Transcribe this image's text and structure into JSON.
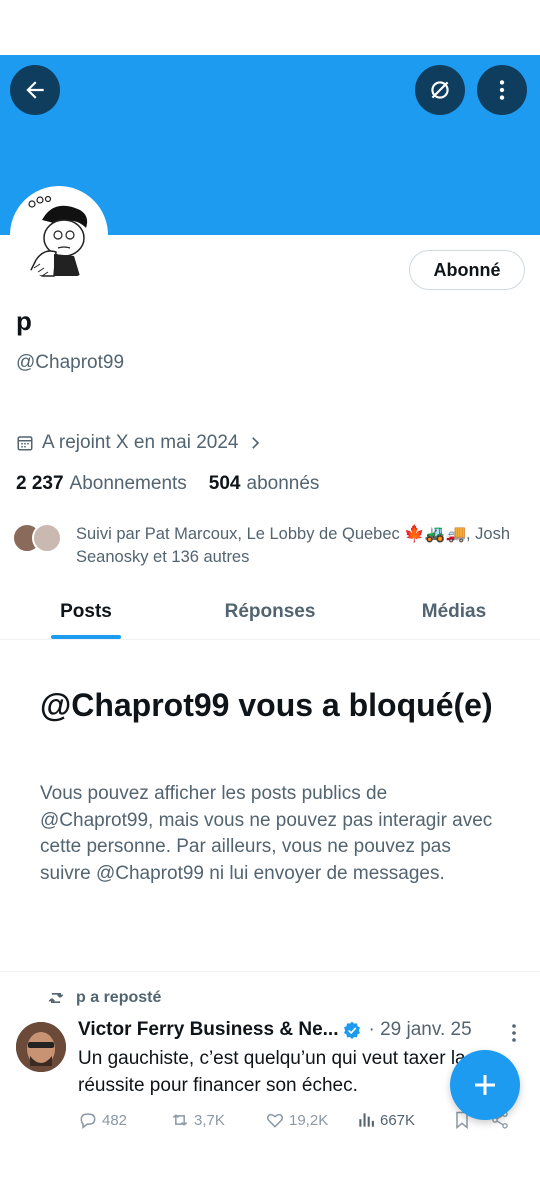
{
  "profile": {
    "display_name": "p",
    "handle": "@Chaprot99",
    "follow_button_label": "Abonné",
    "joined": "A rejoint X en mai 2024",
    "following_count": "2 237",
    "following_label": "Abonnements",
    "followers_count": "504",
    "followers_label": "abonnés",
    "followed_by": "Suivi par Pat Marcoux, Le Lobby de Quebec 🍁🚜🚚, Josh Seanosky et 136 autres"
  },
  "tabs": [
    {
      "label": "Posts",
      "active": true
    },
    {
      "label": "Réponses",
      "active": false
    },
    {
      "label": "Médias",
      "active": false
    }
  ],
  "blocked": {
    "title": "@Chaprot99 vous a bloqué(e)",
    "description": "Vous pouvez afficher les posts publics de @Chaprot99, mais vous ne pouvez pas interagir avec cette personne. Par ailleurs, vous ne pouvez pas suivre @Chaprot99 ni lui envoyer de messages."
  },
  "tweet": {
    "repost_label": "p a reposté",
    "author": "Victor Ferry Business & Ne...",
    "date": "· 29 janv. 25",
    "text": "Un gauchiste, c’est quelqu’un qui veut taxer la réussite pour financer son échec.",
    "replies": "482",
    "reposts": "3,7K",
    "likes": "19,2K",
    "views": "667K"
  },
  "colors": {
    "accent": "#1d9bf0",
    "banner": "#1d9bf0",
    "header_button": "#0f3d5e",
    "text": "#0f1419",
    "muted": "#536471"
  },
  "icons": [
    "back-arrow-icon",
    "no-filter-icon",
    "more-vertical-icon",
    "calendar-icon",
    "chevron-right-icon",
    "repost-icon",
    "verified-icon",
    "reply-icon",
    "like-icon",
    "views-icon",
    "bookmark-icon",
    "share-icon",
    "plus-icon"
  ]
}
